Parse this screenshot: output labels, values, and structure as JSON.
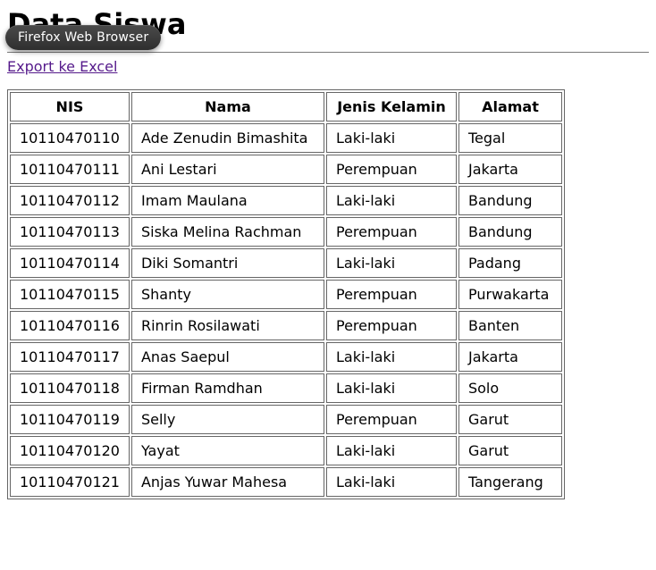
{
  "tooltip": "Firefox Web Browser",
  "heading": "Data Siswa",
  "export_label": "Export ke Excel",
  "table": {
    "headers": {
      "nis": "NIS",
      "nama": "Nama",
      "jk": "Jenis Kelamin",
      "alamat": "Alamat"
    },
    "rows": [
      {
        "nis": "10110470110",
        "nama": "Ade Zenudin Bimashita",
        "jk": "Laki-laki",
        "alamat": "Tegal"
      },
      {
        "nis": "10110470111",
        "nama": "Ani Lestari",
        "jk": "Perempuan",
        "alamat": "Jakarta"
      },
      {
        "nis": "10110470112",
        "nama": "Imam Maulana",
        "jk": "Laki-laki",
        "alamat": "Bandung"
      },
      {
        "nis": "10110470113",
        "nama": "Siska Melina Rachman",
        "jk": "Perempuan",
        "alamat": "Bandung"
      },
      {
        "nis": "10110470114",
        "nama": "Diki Somantri",
        "jk": "Laki-laki",
        "alamat": "Padang"
      },
      {
        "nis": "10110470115",
        "nama": "Shanty",
        "jk": "Perempuan",
        "alamat": "Purwakarta"
      },
      {
        "nis": "10110470116",
        "nama": "Rinrin Rosilawati",
        "jk": "Perempuan",
        "alamat": "Banten"
      },
      {
        "nis": "10110470117",
        "nama": "Anas Saepul",
        "jk": "Laki-laki",
        "alamat": "Jakarta"
      },
      {
        "nis": "10110470118",
        "nama": "Firman Ramdhan",
        "jk": "Laki-laki",
        "alamat": "Solo"
      },
      {
        "nis": "10110470119",
        "nama": "Selly",
        "jk": "Perempuan",
        "alamat": "Garut"
      },
      {
        "nis": "10110470120",
        "nama": "Yayat",
        "jk": "Laki-laki",
        "alamat": "Garut"
      },
      {
        "nis": "10110470121",
        "nama": "Anjas Yuwar Mahesa",
        "jk": "Laki-laki",
        "alamat": "Tangerang"
      }
    ]
  }
}
